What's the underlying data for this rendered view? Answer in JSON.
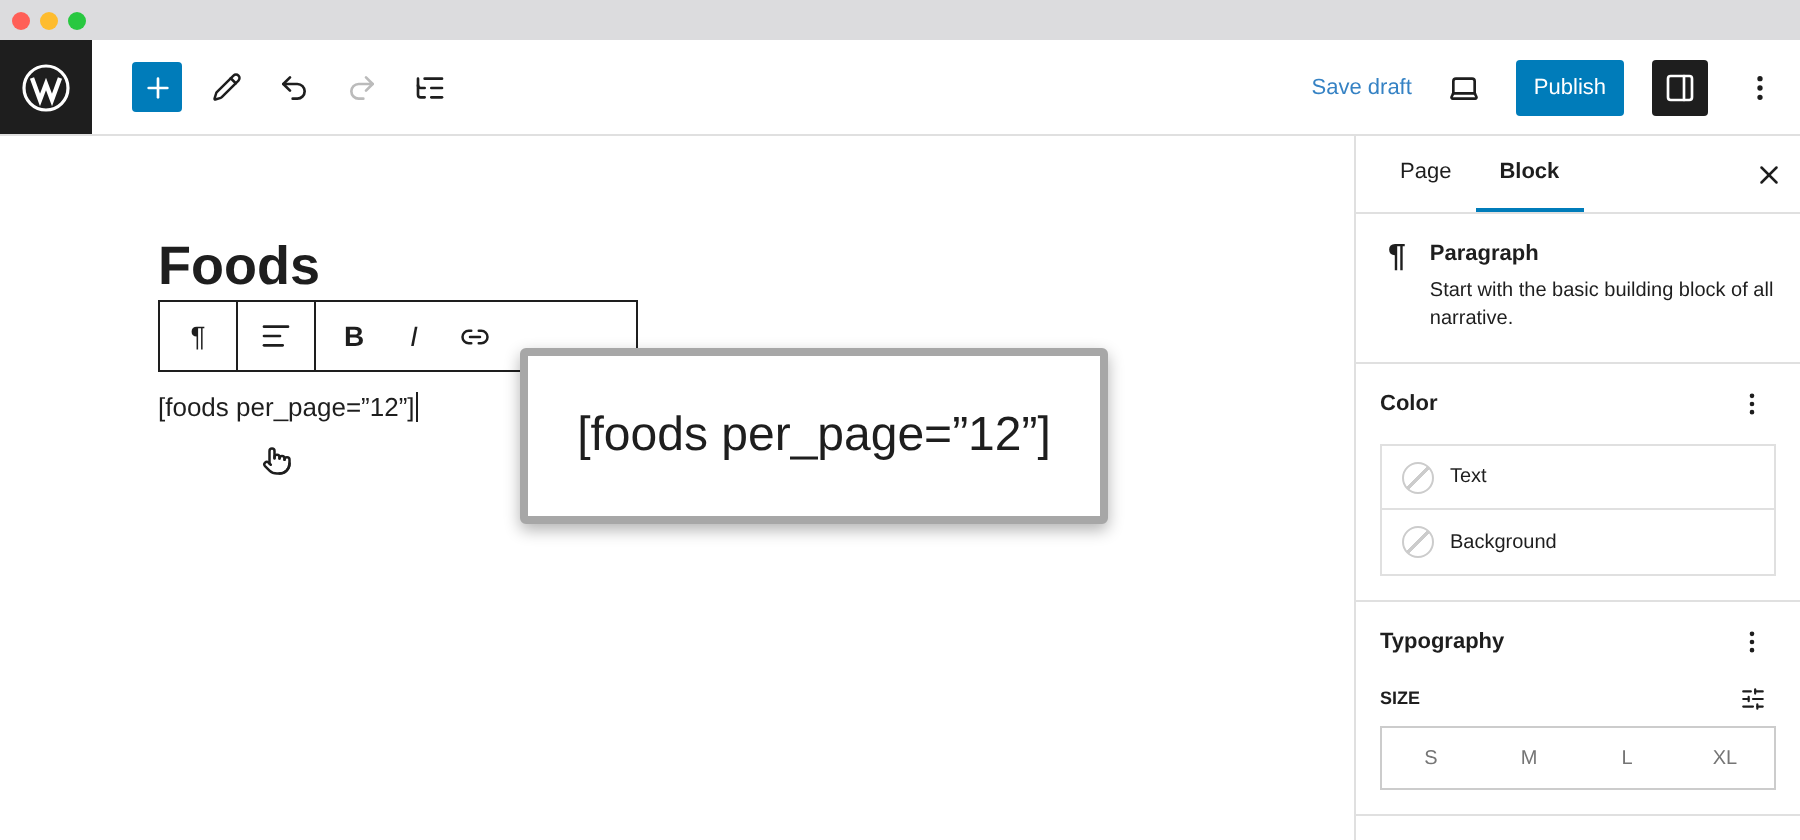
{
  "topbar": {
    "save_draft": "Save draft",
    "publish": "Publish",
    "settings_open": true
  },
  "editor": {
    "title": "Foods",
    "toolbar": {
      "paragraph": "¶",
      "bold": "B",
      "italic": "I"
    },
    "paragraph": "[foods per_page=”12”]"
  },
  "callout": {
    "text": "[foods per_page=”12”]"
  },
  "sidebar": {
    "tabs": [
      {
        "label": "Page",
        "selected": false
      },
      {
        "label": "Block",
        "selected": true
      }
    ],
    "block": {
      "icon": "¶",
      "name": "Paragraph",
      "description": "Start with the basic building block of all narrative."
    },
    "color": {
      "title": "Color",
      "items": [
        "Text",
        "Background"
      ]
    },
    "typography": {
      "title": "Typography",
      "size_label": "SIZE",
      "sizes": [
        {
          "label": "S",
          "selected": false
        },
        {
          "label": "M",
          "selected": false
        },
        {
          "label": "L",
          "selected": false
        },
        {
          "label": "XL",
          "selected": false
        }
      ]
    }
  }
}
